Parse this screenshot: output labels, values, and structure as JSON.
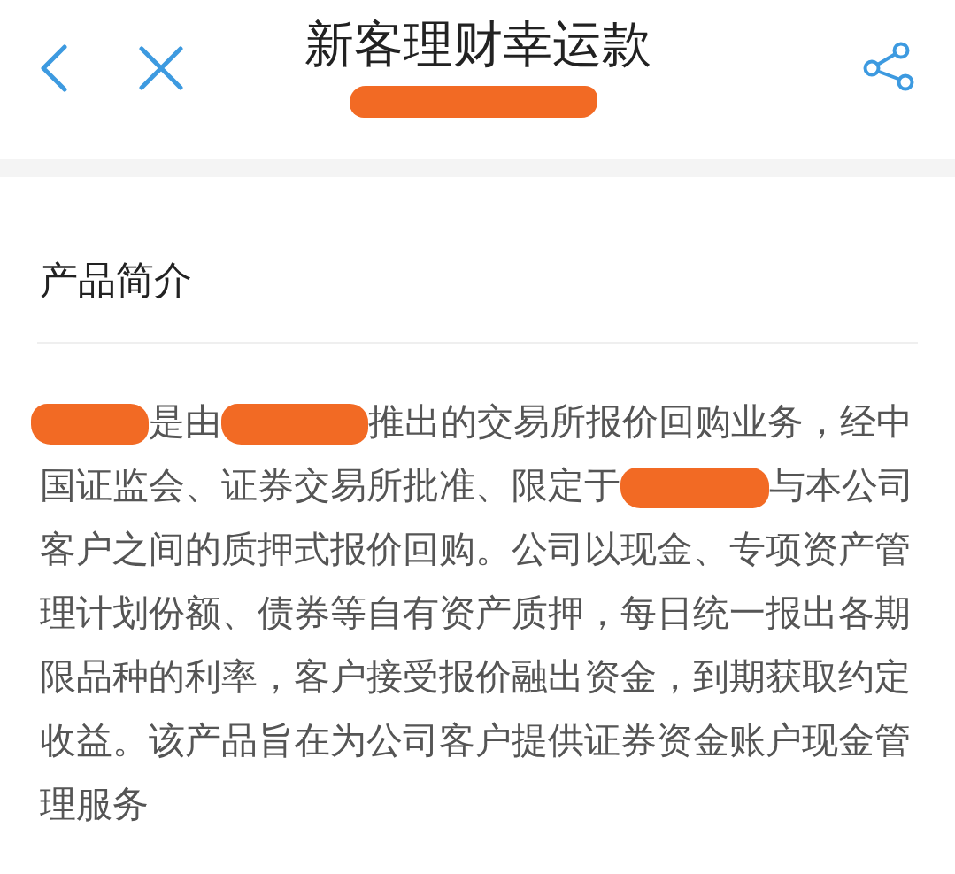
{
  "header": {
    "title": "新客理财幸运款",
    "subtitle_redacted": true
  },
  "section": {
    "heading": "产品简介",
    "body": [
      [
        {
          "kind": "redaction"
        },
        {
          "kind": "text",
          "text": "是由"
        },
        {
          "kind": "redaction"
        },
        {
          "kind": "text",
          "text": "推出的交易所报价回购业务，经中"
        }
      ],
      [
        {
          "kind": "text",
          "text": "国证监会、证券交易所批准、限定于"
        },
        {
          "kind": "redaction"
        },
        {
          "kind": "text",
          "text": "与本公司"
        }
      ],
      [
        {
          "kind": "text",
          "text": "客户之间的质押式报价回购。公司以现金、专项资产管"
        }
      ],
      [
        {
          "kind": "text",
          "text": "理计划份额、债券等自有资产质押，每日统一报出各期"
        }
      ],
      [
        {
          "kind": "text",
          "text": "限品种的利率，客户接受报价融出资金，到期获取约定"
        }
      ],
      [
        {
          "kind": "text",
          "text": "收益。该产品旨在为公司客户提供证券资金账户现金管"
        }
      ],
      [
        {
          "kind": "text",
          "text": "理服务"
        }
      ]
    ]
  }
}
